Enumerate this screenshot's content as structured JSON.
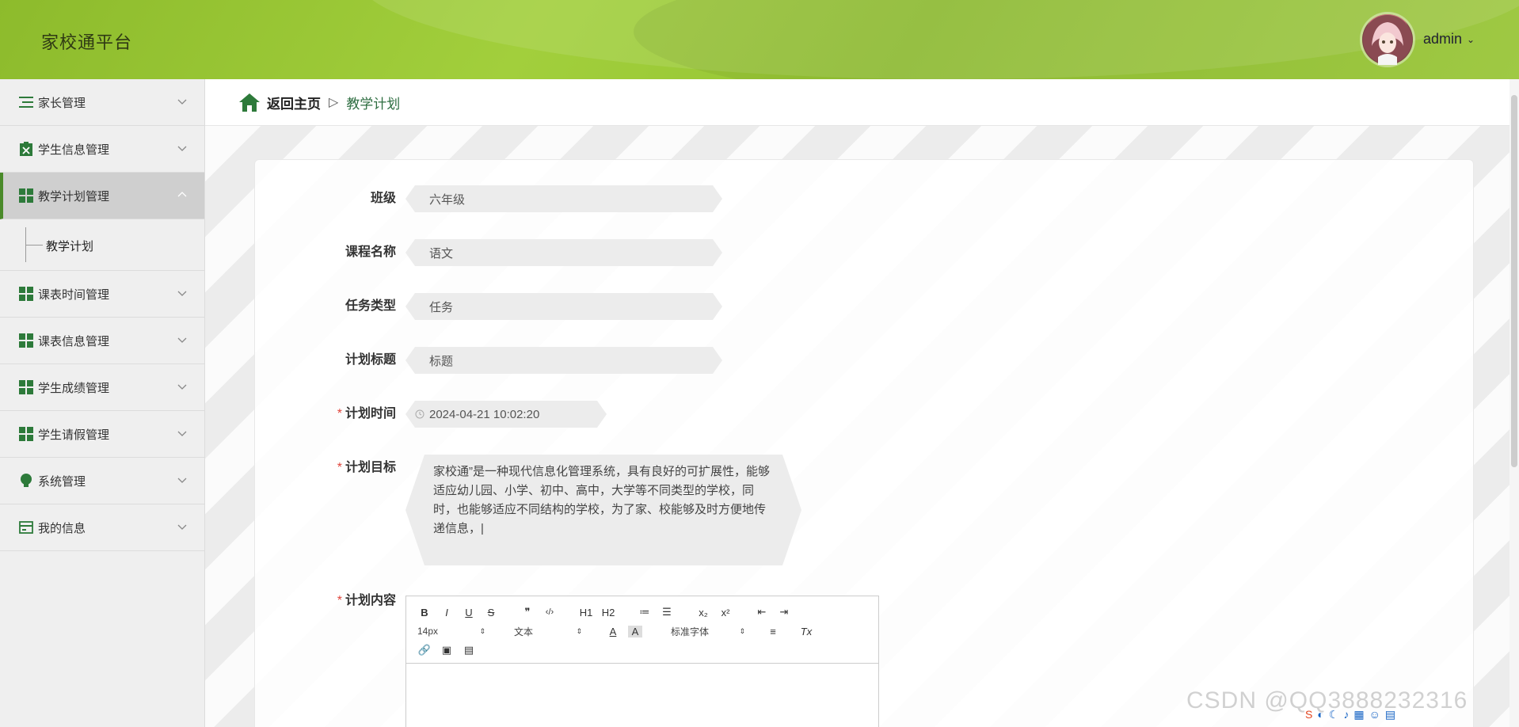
{
  "header": {
    "title": "家校通平台",
    "username": "admin"
  },
  "sidebar": {
    "items": [
      {
        "label": "家长管理"
      },
      {
        "label": "学生信息管理"
      },
      {
        "label": "教学计划管理"
      },
      {
        "label": "课表时间管理"
      },
      {
        "label": "课表信息管理"
      },
      {
        "label": "学生成绩管理"
      },
      {
        "label": "学生请假管理"
      },
      {
        "label": "系统管理"
      },
      {
        "label": "我的信息"
      }
    ],
    "submenu_label": "教学计划"
  },
  "breadcrumb": {
    "home": "返回主页",
    "separator": "▷",
    "current": "教学计划"
  },
  "form": {
    "class_label": "班级",
    "class_value": "六年级",
    "course_label": "课程名称",
    "course_value": "语文",
    "task_label": "任务类型",
    "task_value": "任务",
    "title_label": "计划标题",
    "title_value": "标题",
    "time_label": "计划时间",
    "time_value": "2024-04-21 10:02:20",
    "goal_label": "计划目标",
    "goal_value": "家校通”是一种现代信息化管理系统，具有良好的可扩展性，能够适应幼儿园、小学、初中、高中，大学等不同类型的学校，同时，也能够适应不同结构的学校，为了家、校能够及时方便地传递信息，|",
    "content_label": "计划内容",
    "required_mark": "*"
  },
  "editor": {
    "font_size": "14px",
    "format": "文本",
    "font_family": "标准字体",
    "buttons_row1": [
      "B",
      "I",
      "U",
      "S",
      "❞",
      "‹/›",
      "H1",
      "H2",
      "≔",
      "☰",
      "x₂",
      "x²",
      "⇤",
      "⇥"
    ],
    "buttons_row2_extra": [
      "A",
      "A",
      "≡",
      "Tx"
    ],
    "buttons_row3": [
      "🔗",
      "▣",
      "▤"
    ]
  },
  "watermark": "CSDN @QQ3888232316",
  "colors": {
    "header": "#9dc93a",
    "accent": "#4a8a2a",
    "required": "#e0443b"
  }
}
